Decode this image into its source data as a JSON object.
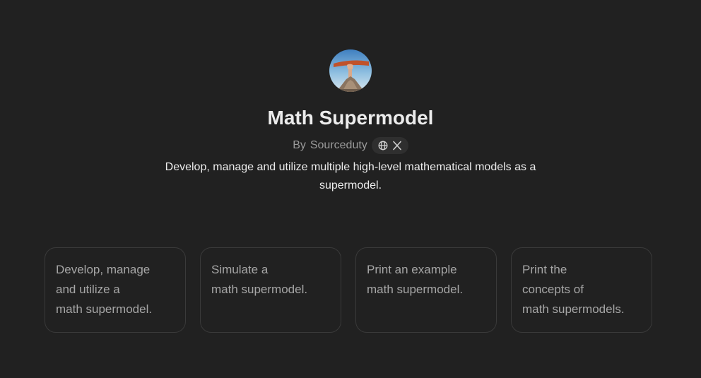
{
  "gpt": {
    "name": "Math Supermodel",
    "author_prefix": "By",
    "author": "Sourceduty",
    "description": "Develop, manage and utilize multiple high-level mathematical models as a supermodel.",
    "links": [
      {
        "icon": "globe-icon"
      },
      {
        "icon": "x-logo-icon"
      }
    ]
  },
  "starters": [
    {
      "lines": [
        "Develop, manage",
        "and utilize a",
        "math supermodel."
      ]
    },
    {
      "lines": [
        "Simulate a",
        "math supermodel."
      ]
    },
    {
      "lines": [
        "Print an example",
        "math supermodel."
      ]
    },
    {
      "lines": [
        "Print the",
        "concepts of",
        "math supermodels."
      ]
    }
  ],
  "colors": {
    "background": "#212121",
    "card_border": "#3a3a3a",
    "text_primary": "#ececec",
    "text_secondary": "#9b9b9b"
  }
}
